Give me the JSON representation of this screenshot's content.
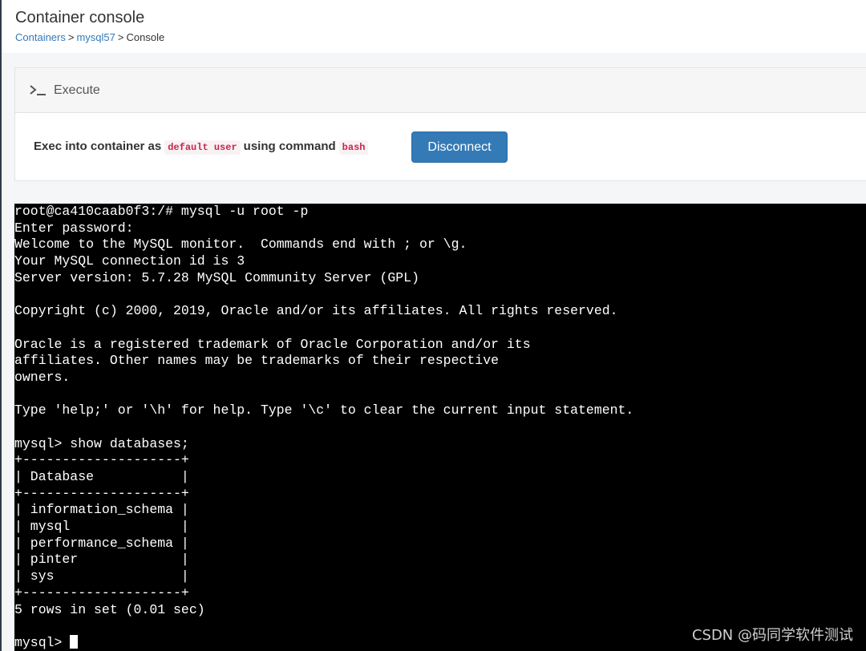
{
  "header": {
    "title": "Container console",
    "breadcrumb": [
      {
        "label": "Containers",
        "link": true
      },
      {
        "label": "mysql57",
        "link": true
      },
      {
        "label": "Console",
        "link": false
      }
    ],
    "separator": ">"
  },
  "execute": {
    "title": "Execute",
    "icon": "terminal-prompt-icon",
    "exec_prefix": "Exec into container as",
    "user": "default user",
    "using_command": "using command",
    "command": "bash",
    "disconnect_label": "Disconnect"
  },
  "terminal": {
    "lines": [
      "root@ca410caab0f3:/# mysql -u root -p",
      "Enter password:",
      "Welcome to the MySQL monitor.  Commands end with ; or \\g.",
      "Your MySQL connection id is 3",
      "Server version: 5.7.28 MySQL Community Server (GPL)",
      "",
      "Copyright (c) 2000, 2019, Oracle and/or its affiliates. All rights reserved.",
      "",
      "Oracle is a registered trademark of Oracle Corporation and/or its",
      "affiliates. Other names may be trademarks of their respective",
      "owners.",
      "",
      "Type 'help;' or '\\h' for help. Type '\\c' to clear the current input statement.",
      "",
      "mysql> show databases;",
      "+--------------------+",
      "| Database           |",
      "+--------------------+",
      "| information_schema |",
      "| mysql              |",
      "| performance_schema |",
      "| pinter             |",
      "| sys                |",
      "+--------------------+",
      "5 rows in set (0.01 sec)",
      ""
    ],
    "prompt": "mysql> "
  },
  "watermark": "CSDN @码同学软件测试",
  "colors": {
    "accent": "#337ab7",
    "code_text": "#c7254e",
    "code_bg": "#f9f2f4",
    "terminal_bg": "#000000",
    "terminal_fg": "#ffffff"
  }
}
